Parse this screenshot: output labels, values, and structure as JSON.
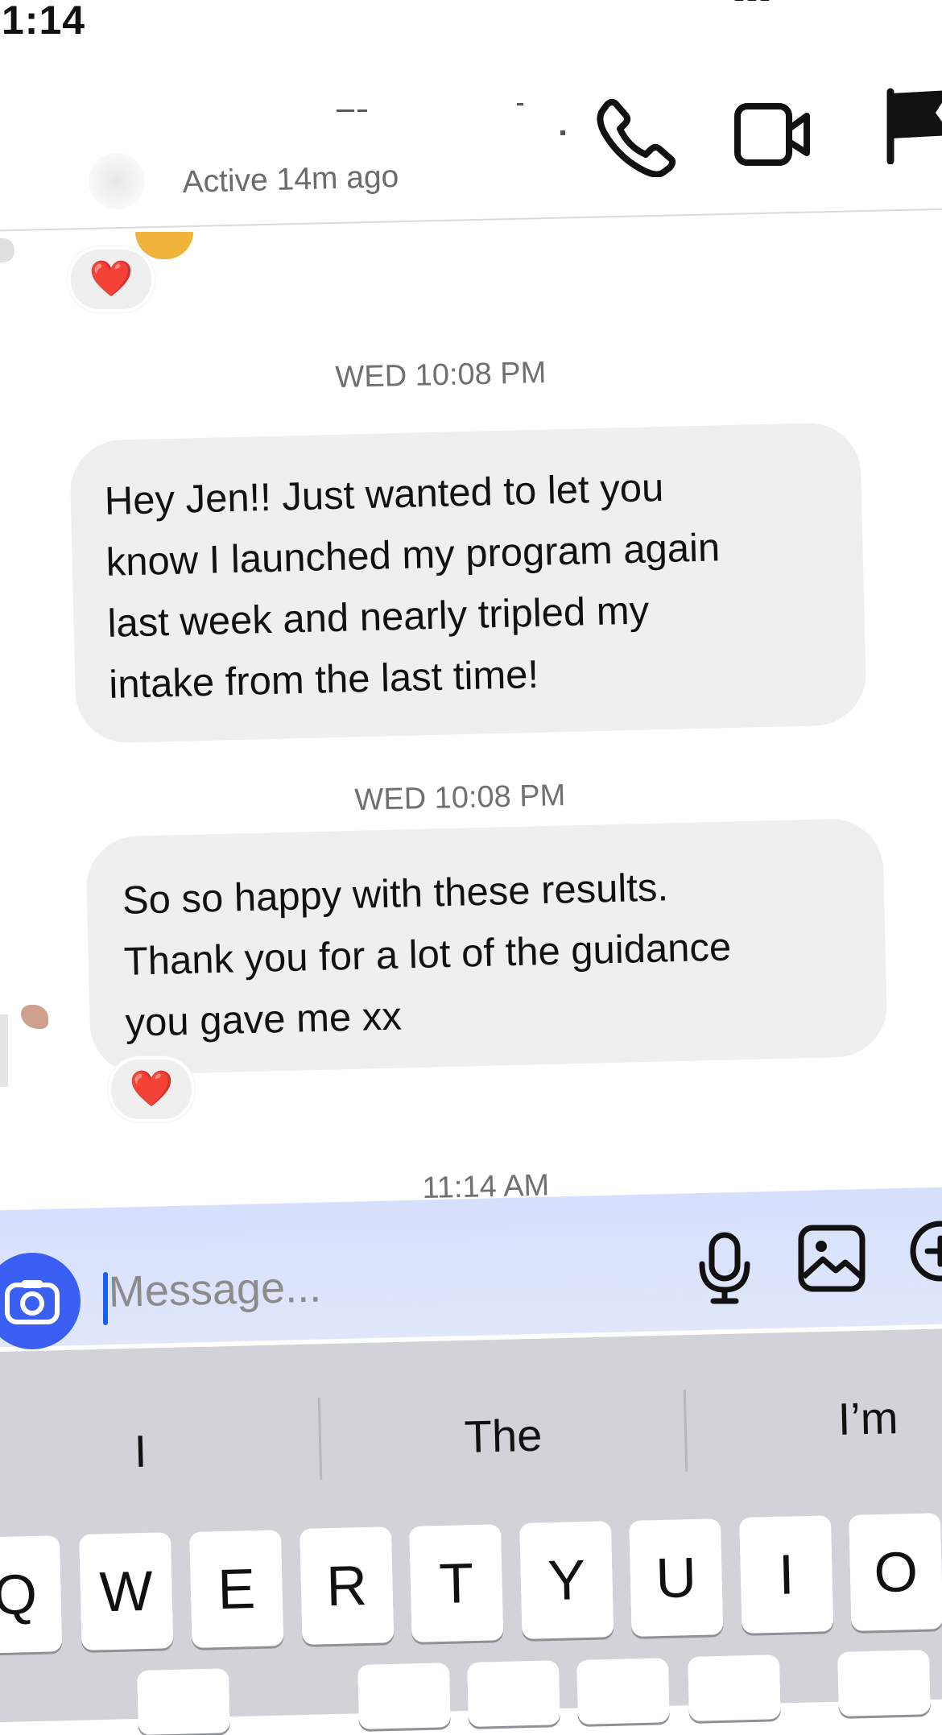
{
  "status_bar": {
    "time": "1:14"
  },
  "header": {
    "active_status": "Active 14m ago",
    "icons": [
      "phone-icon",
      "video-camera-icon",
      "flag-icon"
    ]
  },
  "chat": {
    "messages": [
      {
        "timestamp": "WED 10:08 PM",
        "text": "Hey Jen!! Just wanted to let you know I launched my program again last week and nearly tripled my intake from the last time!",
        "lines": [
          "Hey Jen!! Just wanted to let you",
          "know I launched my program again",
          "last week and nearly tripled my",
          "intake from the last time!"
        ]
      },
      {
        "timestamp": "WED 10:08 PM",
        "text": "So so happy with these results. Thank you for a lot of the guidance you gave me xx",
        "lines": [
          "So so happy with these results.",
          "Thank you for a lot of the guidance",
          "you gave me xx"
        ]
      }
    ],
    "reactions": [
      "❤️",
      "❤️"
    ],
    "latest_timestamp": "11:14 AM"
  },
  "composer": {
    "placeholder": "Message...",
    "icons": [
      "camera-icon",
      "microphone-icon",
      "gallery-icon",
      "plus-icon"
    ],
    "accent": "#3b5ff2",
    "bg": "#dce3fb"
  },
  "keyboard": {
    "suggestions": [
      "I",
      "The",
      "I’m"
    ],
    "row1": [
      "Q",
      "W",
      "E",
      "R",
      "T",
      "Y",
      "U",
      "I",
      "O"
    ]
  }
}
